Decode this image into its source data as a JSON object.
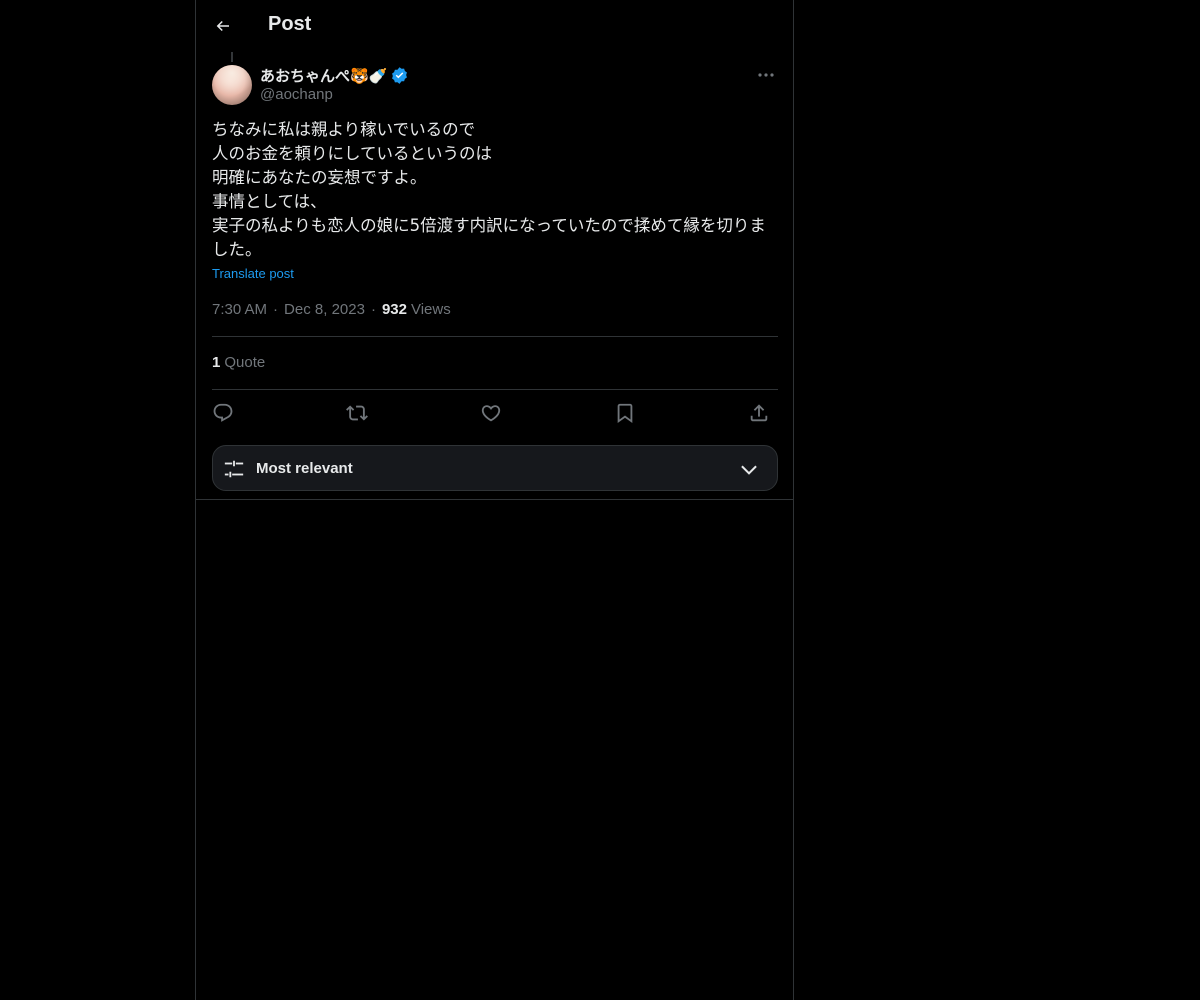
{
  "header": {
    "title": "Post"
  },
  "post": {
    "author_name": "あおちゃんぺ🐯🍼",
    "handle": "@aochanp",
    "text": "ちなみに私は親より稼いでいるので\n人のお金を頼りにしているというのは\n明確にあなたの妄想ですよ。\n事情としては、\n実子の私よりも恋人の娘に5倍渡す内訳になっていたので揉めて縁を切りました。",
    "translate_label": "Translate post",
    "time": "7:30 AM",
    "date": "Dec 8, 2023",
    "views_count": "932",
    "views_label": "Views",
    "quote_count": "1",
    "quote_label": "Quote"
  },
  "sort": {
    "label": "Most relevant"
  },
  "icons": {
    "back": "arrow-left-icon",
    "verified": "verified-badge-icon",
    "more": "more-horizontal-icon",
    "reply": "reply-icon",
    "repost": "repost-icon",
    "like": "heart-icon",
    "bookmark": "bookmark-icon",
    "share": "share-icon",
    "sort": "sliders-icon",
    "chevron": "chevron-down-icon"
  },
  "colors": {
    "background": "#000000",
    "text_primary": "#e7e9ea",
    "text_secondary": "#71767b",
    "accent": "#1d9bf0",
    "border": "#2f3336"
  }
}
